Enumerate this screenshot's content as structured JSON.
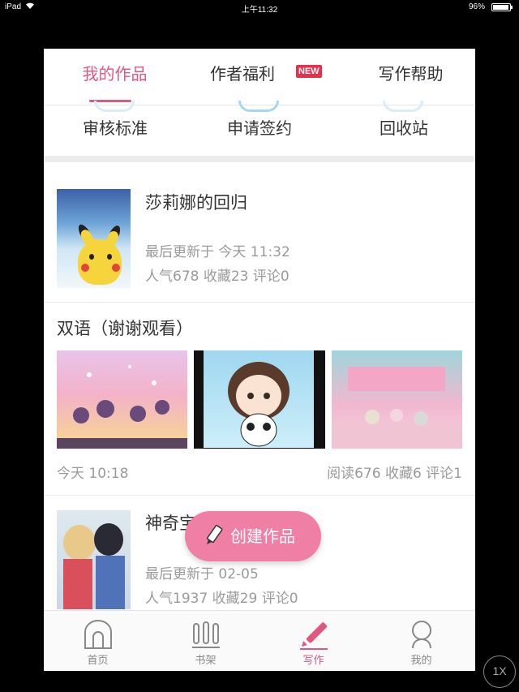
{
  "status_bar": {
    "carrier": "iPad",
    "time": "上午11:32",
    "battery": "96%",
    "battery_level": 0.96
  },
  "top_tabs": {
    "my_works": "我的作品",
    "author_benefits": "作者福利",
    "new_badge": "NEW",
    "writing_help": "写作帮助"
  },
  "quick_actions": {
    "review_standards": "审核标准",
    "apply_contract": "申请签约",
    "recycle_bin": "回收站"
  },
  "works": [
    {
      "title": "莎莉娜的回归",
      "updated": "最后更新于 今天 11:32",
      "stats": "人气678 收藏23 评论0"
    },
    {
      "title": "双语（谢谢观看）",
      "time": "今天 10:18",
      "stats": "阅读676 收藏6 评论1"
    },
    {
      "title": "神奇宝",
      "updated": "最后更新于 02-05",
      "stats": "人气1937 收藏29 评论0"
    }
  ],
  "fab": {
    "label": "创建作品"
  },
  "tab_bar": {
    "home": "首页",
    "bookshelf": "书架",
    "write": "写作",
    "mine": "我的"
  },
  "zoom": "1X",
  "colors": {
    "accent": "#e0577f",
    "fab": "#f07fa6",
    "new_badge": "#e8304e"
  }
}
